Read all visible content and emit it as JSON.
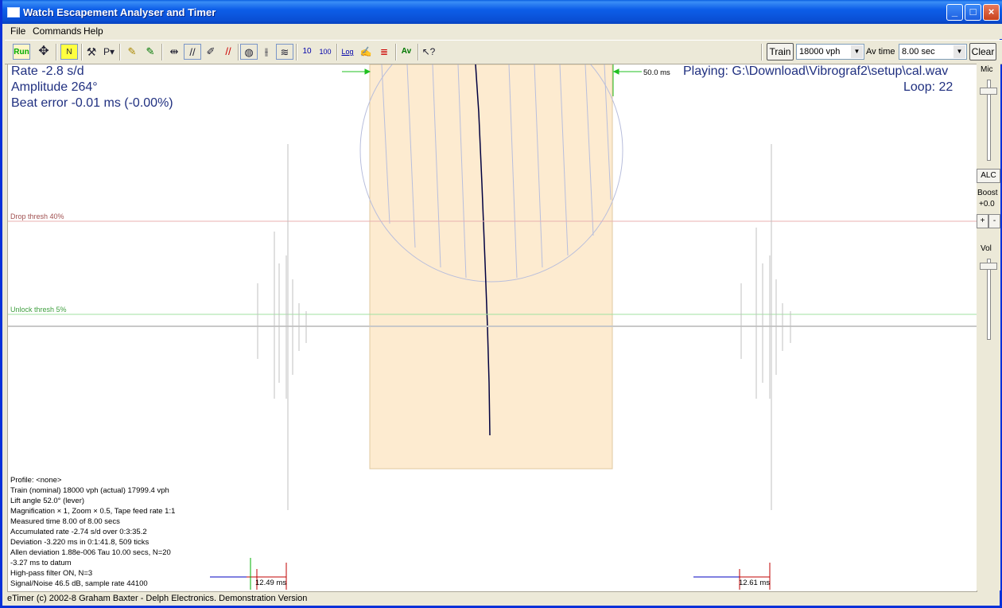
{
  "window": {
    "title": "Watch Escapement Analyser and Timer"
  },
  "menu": [
    "File",
    "Commands",
    "Help"
  ],
  "toolbar": {
    "run_label": "Run",
    "train_label": "Train",
    "train_value": "18000 vph",
    "avtime_label": "Av time",
    "avtime_value": "8.00 sec",
    "clear_label": "Clear",
    "scale_10": "10",
    "scale_100": "100",
    "log_label": "Log",
    "av_label": "Av"
  },
  "readout": {
    "rate": "Rate   -2.8 s/d",
    "amplitude": "Amplitude 264°",
    "beat_error": "Beat error -0.01 ms (-0.00%)",
    "playing": "Playing:  G:\\Download\\Vibrograf2\\setup\\cal.wav",
    "loop": "Loop:  22",
    "scale_ms": "50.0 ms"
  },
  "thresholds": {
    "drop": "Drop thresh 40%",
    "unlock": "Unlock thresh 5%"
  },
  "info_lines": [
    "Profile: <none>",
    "Train (nominal) 18000 vph (actual) 17999.4 vph",
    "Lift angle  52.0° (lever)",
    "Magnification × 1, Zoom × 0.5, Tape feed rate 1:1",
    "Measured time 8.00 of 8.00 secs",
    "Accumulated rate -2.74 s/d over 0:3:35.2",
    "Deviation -3.220 ms in 0:1:41.8, 509 ticks",
    "Allen deviation 1.88e-006 Tau 10.00 secs, N=20",
    " -3.27 ms to datum",
    "High-pass filter ON, N=3",
    "Signal/Noise 46.5 dB, sample rate 44100"
  ],
  "markers": {
    "left": "12.49 ms",
    "right": "12.61 ms"
  },
  "sidepanel": {
    "mic": "Mic",
    "alc": "ALC",
    "boost": "Boost",
    "boost_val": "+0.0",
    "plus": "+",
    "minus": "-",
    "vol": "Vol"
  },
  "status": "eTimer (c) 2002-8 Graham Baxter - Delph Electronics. Demonstration Version",
  "colors": {
    "title_blue": "#0a4fd4",
    "panel_peach": "#fdebd0",
    "text_blue": "#203080"
  }
}
